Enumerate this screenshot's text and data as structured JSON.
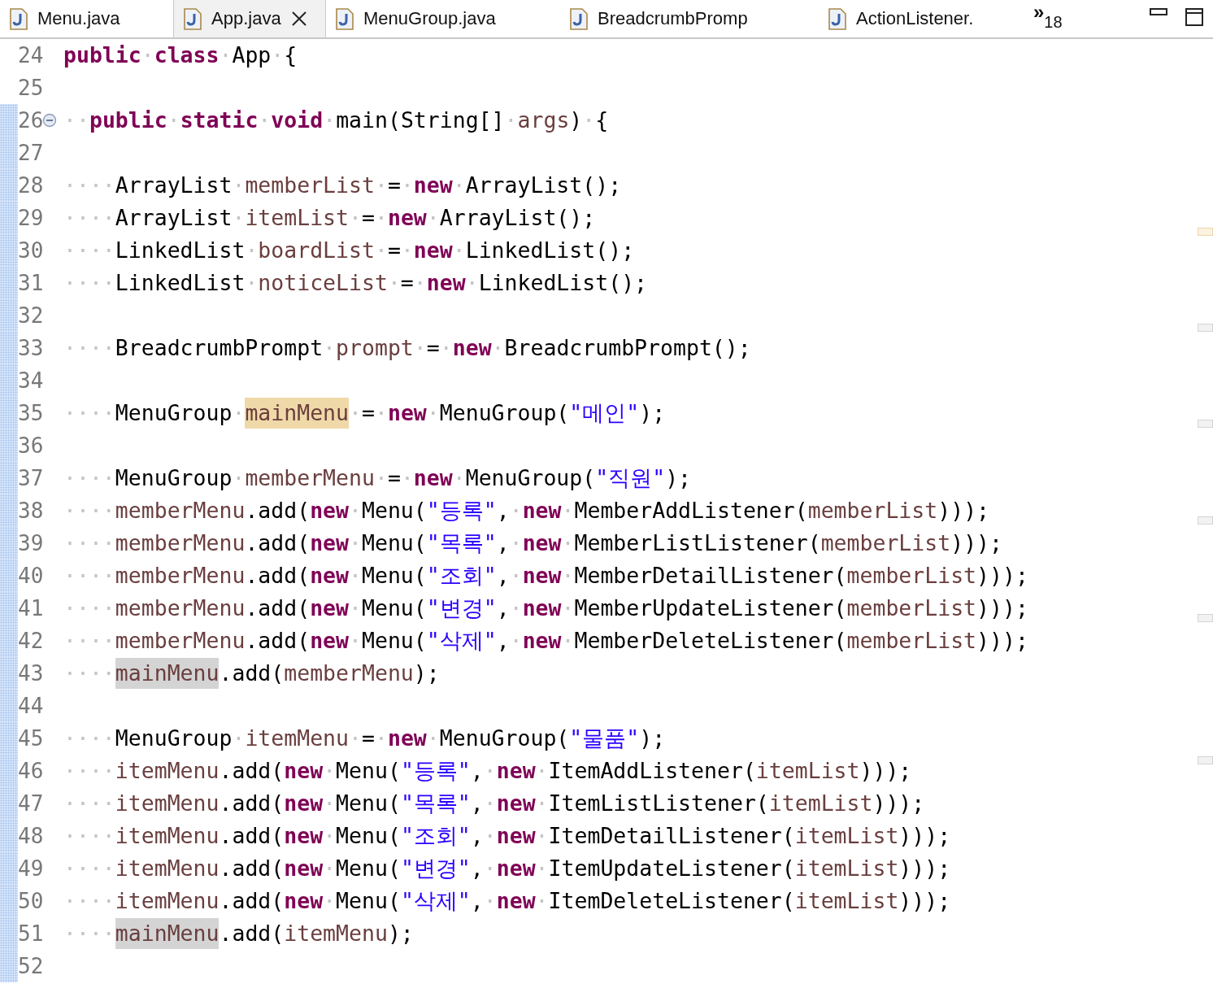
{
  "tabs": [
    {
      "label": "Menu.java",
      "selected": false
    },
    {
      "label": "App.java",
      "selected": true
    },
    {
      "label": "MenuGroup.java",
      "selected": false
    },
    {
      "label": "BreadcrumbPromp",
      "selected": false
    },
    {
      "label": "ActionListener.",
      "selected": false
    }
  ],
  "overflow": {
    "glyph": "»",
    "count": "18"
  },
  "lines": [
    {
      "number": "24",
      "in_range": false,
      "tokens": [
        {
          "kind": "kw",
          "text": "public"
        },
        {
          "kind": "ws",
          "text": "·"
        },
        {
          "kind": "kw",
          "text": "class"
        },
        {
          "kind": "ws",
          "text": "·"
        },
        {
          "kind": "id",
          "text": "App"
        },
        {
          "kind": "ws",
          "text": "·"
        },
        {
          "kind": "id",
          "text": "{"
        }
      ]
    },
    {
      "number": "25",
      "in_range": false
    },
    {
      "number": "26",
      "in_range": true,
      "collapsed": false,
      "tokens": [
        {
          "kind": "ws",
          "text": "··"
        },
        {
          "kind": "kw",
          "text": "public"
        },
        {
          "kind": "ws",
          "text": "·"
        },
        {
          "kind": "kw",
          "text": "static"
        },
        {
          "kind": "ws",
          "text": "·"
        },
        {
          "kind": "kw",
          "text": "void"
        },
        {
          "kind": "ws",
          "text": "·"
        },
        {
          "kind": "id",
          "text": "main(String[]"
        },
        {
          "kind": "ws",
          "text": "·"
        },
        {
          "kind": "var",
          "text": "args"
        },
        {
          "kind": "id",
          "text": ")"
        },
        {
          "kind": "ws",
          "text": "·"
        },
        {
          "kind": "id",
          "text": "{"
        }
      ]
    },
    {
      "number": "27",
      "in_range": true
    },
    {
      "number": "28",
      "in_range": true,
      "tokens": [
        {
          "kind": "ws",
          "text": "····"
        },
        {
          "kind": "id",
          "text": "ArrayList"
        },
        {
          "kind": "ws",
          "text": "·"
        },
        {
          "kind": "var",
          "text": "memberList"
        },
        {
          "kind": "ws",
          "text": "·"
        },
        {
          "kind": "id",
          "text": "="
        },
        {
          "kind": "ws",
          "text": "·"
        },
        {
          "kind": "kw",
          "text": "new"
        },
        {
          "kind": "ws",
          "text": "·"
        },
        {
          "kind": "id",
          "text": "ArrayList();"
        }
      ]
    },
    {
      "number": "29",
      "in_range": true,
      "tokens": [
        {
          "kind": "ws",
          "text": "····"
        },
        {
          "kind": "id",
          "text": "ArrayList"
        },
        {
          "kind": "ws",
          "text": "·"
        },
        {
          "kind": "var",
          "text": "itemList"
        },
        {
          "kind": "ws",
          "text": "·"
        },
        {
          "kind": "id",
          "text": "="
        },
        {
          "kind": "ws",
          "text": "·"
        },
        {
          "kind": "kw",
          "text": "new"
        },
        {
          "kind": "ws",
          "text": "·"
        },
        {
          "kind": "id",
          "text": "ArrayList();"
        }
      ]
    },
    {
      "number": "30",
      "in_range": true,
      "tokens": [
        {
          "kind": "ws",
          "text": "····"
        },
        {
          "kind": "id",
          "text": "LinkedList"
        },
        {
          "kind": "ws",
          "text": "·"
        },
        {
          "kind": "var",
          "text": "boardList"
        },
        {
          "kind": "ws",
          "text": "·"
        },
        {
          "kind": "id",
          "text": "="
        },
        {
          "kind": "ws",
          "text": "·"
        },
        {
          "kind": "kw",
          "text": "new"
        },
        {
          "kind": "ws",
          "text": "·"
        },
        {
          "kind": "id",
          "text": "LinkedList();"
        }
      ]
    },
    {
      "number": "31",
      "in_range": true,
      "tokens": [
        {
          "kind": "ws",
          "text": "····"
        },
        {
          "kind": "id",
          "text": "LinkedList"
        },
        {
          "kind": "ws",
          "text": "·"
        },
        {
          "kind": "var",
          "text": "noticeList"
        },
        {
          "kind": "ws",
          "text": "·"
        },
        {
          "kind": "id",
          "text": "="
        },
        {
          "kind": "ws",
          "text": "·"
        },
        {
          "kind": "kw",
          "text": "new"
        },
        {
          "kind": "ws",
          "text": "·"
        },
        {
          "kind": "id",
          "text": "LinkedList();"
        }
      ]
    },
    {
      "number": "32",
      "in_range": true
    },
    {
      "number": "33",
      "in_range": true,
      "tokens": [
        {
          "kind": "ws",
          "text": "····"
        },
        {
          "kind": "id",
          "text": "BreadcrumbPrompt"
        },
        {
          "kind": "ws",
          "text": "·"
        },
        {
          "kind": "var",
          "text": "prompt"
        },
        {
          "kind": "ws",
          "text": "·"
        },
        {
          "kind": "id",
          "text": "="
        },
        {
          "kind": "ws",
          "text": "·"
        },
        {
          "kind": "kw",
          "text": "new"
        },
        {
          "kind": "ws",
          "text": "·"
        },
        {
          "kind": "id",
          "text": "BreadcrumbPrompt();"
        }
      ]
    },
    {
      "number": "34",
      "in_range": true
    },
    {
      "number": "35",
      "in_range": true,
      "tokens": [
        {
          "kind": "ws",
          "text": "····"
        },
        {
          "kind": "id",
          "text": "MenuGroup"
        },
        {
          "kind": "ws",
          "text": "·"
        },
        {
          "kind": "var",
          "text": "mainMenu",
          "highlighted": true,
          "write_access": true
        },
        {
          "kind": "ws",
          "text": "·"
        },
        {
          "kind": "id",
          "text": "="
        },
        {
          "kind": "ws",
          "text": "·"
        },
        {
          "kind": "kw",
          "text": "new"
        },
        {
          "kind": "ws",
          "text": "·"
        },
        {
          "kind": "id",
          "text": "MenuGroup("
        },
        {
          "kind": "str",
          "text": "\"메인\""
        },
        {
          "kind": "id",
          "text": ");"
        }
      ]
    },
    {
      "number": "36",
      "in_range": true
    },
    {
      "number": "37",
      "in_range": true,
      "tokens": [
        {
          "kind": "ws",
          "text": "····"
        },
        {
          "kind": "id",
          "text": "MenuGroup"
        },
        {
          "kind": "ws",
          "text": "·"
        },
        {
          "kind": "var",
          "text": "memberMenu"
        },
        {
          "kind": "ws",
          "text": "·"
        },
        {
          "kind": "id",
          "text": "="
        },
        {
          "kind": "ws",
          "text": "·"
        },
        {
          "kind": "kw",
          "text": "new"
        },
        {
          "kind": "ws",
          "text": "·"
        },
        {
          "kind": "id",
          "text": "MenuGroup("
        },
        {
          "kind": "str",
          "text": "\"직원\""
        },
        {
          "kind": "id",
          "text": ");"
        }
      ]
    },
    {
      "number": "38",
      "in_range": true,
      "tokens": [
        {
          "kind": "ws",
          "text": "····"
        },
        {
          "kind": "var",
          "text": "memberMenu"
        },
        {
          "kind": "id",
          "text": ".add("
        },
        {
          "kind": "kw",
          "text": "new"
        },
        {
          "kind": "ws",
          "text": "·"
        },
        {
          "kind": "id",
          "text": "Menu("
        },
        {
          "kind": "str",
          "text": "\"등록\""
        },
        {
          "kind": "id",
          "text": ","
        },
        {
          "kind": "ws",
          "text": "·"
        },
        {
          "kind": "kw",
          "text": "new"
        },
        {
          "kind": "ws",
          "text": "·"
        },
        {
          "kind": "id",
          "text": "MemberAddListener("
        },
        {
          "kind": "var",
          "text": "memberList"
        },
        {
          "kind": "id",
          "text": ")));"
        }
      ]
    },
    {
      "number": "39",
      "in_range": true,
      "tokens": [
        {
          "kind": "ws",
          "text": "····"
        },
        {
          "kind": "var",
          "text": "memberMenu"
        },
        {
          "kind": "id",
          "text": ".add("
        },
        {
          "kind": "kw",
          "text": "new"
        },
        {
          "kind": "ws",
          "text": "·"
        },
        {
          "kind": "id",
          "text": "Menu("
        },
        {
          "kind": "str",
          "text": "\"목록\""
        },
        {
          "kind": "id",
          "text": ","
        },
        {
          "kind": "ws",
          "text": "·"
        },
        {
          "kind": "kw",
          "text": "new"
        },
        {
          "kind": "ws",
          "text": "·"
        },
        {
          "kind": "id",
          "text": "MemberListListener("
        },
        {
          "kind": "var",
          "text": "memberList"
        },
        {
          "kind": "id",
          "text": ")));"
        }
      ]
    },
    {
      "number": "40",
      "in_range": true,
      "tokens": [
        {
          "kind": "ws",
          "text": "····"
        },
        {
          "kind": "var",
          "text": "memberMenu"
        },
        {
          "kind": "id",
          "text": ".add("
        },
        {
          "kind": "kw",
          "text": "new"
        },
        {
          "kind": "ws",
          "text": "·"
        },
        {
          "kind": "id",
          "text": "Menu("
        },
        {
          "kind": "str",
          "text": "\"조회\""
        },
        {
          "kind": "id",
          "text": ","
        },
        {
          "kind": "ws",
          "text": "·"
        },
        {
          "kind": "kw",
          "text": "new"
        },
        {
          "kind": "ws",
          "text": "·"
        },
        {
          "kind": "id",
          "text": "MemberDetailListener("
        },
        {
          "kind": "var",
          "text": "memberList"
        },
        {
          "kind": "id",
          "text": ")));"
        }
      ]
    },
    {
      "number": "41",
      "in_range": true,
      "tokens": [
        {
          "kind": "ws",
          "text": "····"
        },
        {
          "kind": "var",
          "text": "memberMenu"
        },
        {
          "kind": "id",
          "text": ".add("
        },
        {
          "kind": "kw",
          "text": "new"
        },
        {
          "kind": "ws",
          "text": "·"
        },
        {
          "kind": "id",
          "text": "Menu("
        },
        {
          "kind": "str",
          "text": "\"변경\""
        },
        {
          "kind": "id",
          "text": ","
        },
        {
          "kind": "ws",
          "text": "·"
        },
        {
          "kind": "kw",
          "text": "new"
        },
        {
          "kind": "ws",
          "text": "·"
        },
        {
          "kind": "id",
          "text": "MemberUpdateListener("
        },
        {
          "kind": "var",
          "text": "memberList"
        },
        {
          "kind": "id",
          "text": ")));"
        }
      ]
    },
    {
      "number": "42",
      "in_range": true,
      "tokens": [
        {
          "kind": "ws",
          "text": "····"
        },
        {
          "kind": "var",
          "text": "memberMenu"
        },
        {
          "kind": "id",
          "text": ".add("
        },
        {
          "kind": "kw",
          "text": "new"
        },
        {
          "kind": "ws",
          "text": "·"
        },
        {
          "kind": "id",
          "text": "Menu("
        },
        {
          "kind": "str",
          "text": "\"삭제\""
        },
        {
          "kind": "id",
          "text": ","
        },
        {
          "kind": "ws",
          "text": "·"
        },
        {
          "kind": "kw",
          "text": "new"
        },
        {
          "kind": "ws",
          "text": "·"
        },
        {
          "kind": "id",
          "text": "MemberDeleteListener("
        },
        {
          "kind": "var",
          "text": "memberList"
        },
        {
          "kind": "id",
          "text": ")));"
        }
      ]
    },
    {
      "number": "43",
      "in_range": true,
      "tokens": [
        {
          "kind": "ws",
          "text": "····"
        },
        {
          "kind": "var",
          "text": "mainMenu",
          "highlighted": true,
          "write_access": false
        },
        {
          "kind": "id",
          "text": ".add("
        },
        {
          "kind": "var",
          "text": "memberMenu"
        },
        {
          "kind": "id",
          "text": ");"
        }
      ]
    },
    {
      "number": "44",
      "in_range": true
    },
    {
      "number": "45",
      "in_range": true,
      "tokens": [
        {
          "kind": "ws",
          "text": "····"
        },
        {
          "kind": "id",
          "text": "MenuGroup"
        },
        {
          "kind": "ws",
          "text": "·"
        },
        {
          "kind": "var",
          "text": "itemMenu"
        },
        {
          "kind": "ws",
          "text": "·"
        },
        {
          "kind": "id",
          "text": "="
        },
        {
          "kind": "ws",
          "text": "·"
        },
        {
          "kind": "kw",
          "text": "new"
        },
        {
          "kind": "ws",
          "text": "·"
        },
        {
          "kind": "id",
          "text": "MenuGroup("
        },
        {
          "kind": "str",
          "text": "\"물품\""
        },
        {
          "kind": "id",
          "text": ");"
        }
      ]
    },
    {
      "number": "46",
      "in_range": true,
      "tokens": [
        {
          "kind": "ws",
          "text": "····"
        },
        {
          "kind": "var",
          "text": "itemMenu"
        },
        {
          "kind": "id",
          "text": ".add("
        },
        {
          "kind": "kw",
          "text": "new"
        },
        {
          "kind": "ws",
          "text": "·"
        },
        {
          "kind": "id",
          "text": "Menu("
        },
        {
          "kind": "str",
          "text": "\"등록\""
        },
        {
          "kind": "id",
          "text": ","
        },
        {
          "kind": "ws",
          "text": "·"
        },
        {
          "kind": "kw",
          "text": "new"
        },
        {
          "kind": "ws",
          "text": "·"
        },
        {
          "kind": "id",
          "text": "ItemAddListener("
        },
        {
          "kind": "var",
          "text": "itemList"
        },
        {
          "kind": "id",
          "text": ")));"
        }
      ]
    },
    {
      "number": "47",
      "in_range": true,
      "tokens": [
        {
          "kind": "ws",
          "text": "····"
        },
        {
          "kind": "var",
          "text": "itemMenu"
        },
        {
          "kind": "id",
          "text": ".add("
        },
        {
          "kind": "kw",
          "text": "new"
        },
        {
          "kind": "ws",
          "text": "·"
        },
        {
          "kind": "id",
          "text": "Menu("
        },
        {
          "kind": "str",
          "text": "\"목록\""
        },
        {
          "kind": "id",
          "text": ","
        },
        {
          "kind": "ws",
          "text": "·"
        },
        {
          "kind": "kw",
          "text": "new"
        },
        {
          "kind": "ws",
          "text": "·"
        },
        {
          "kind": "id",
          "text": "ItemListListener("
        },
        {
          "kind": "var",
          "text": "itemList"
        },
        {
          "kind": "id",
          "text": ")));"
        }
      ]
    },
    {
      "number": "48",
      "in_range": true,
      "tokens": [
        {
          "kind": "ws",
          "text": "····"
        },
        {
          "kind": "var",
          "text": "itemMenu"
        },
        {
          "kind": "id",
          "text": ".add("
        },
        {
          "kind": "kw",
          "text": "new"
        },
        {
          "kind": "ws",
          "text": "·"
        },
        {
          "kind": "id",
          "text": "Menu("
        },
        {
          "kind": "str",
          "text": "\"조회\""
        },
        {
          "kind": "id",
          "text": ","
        },
        {
          "kind": "ws",
          "text": "·"
        },
        {
          "kind": "kw",
          "text": "new"
        },
        {
          "kind": "ws",
          "text": "·"
        },
        {
          "kind": "id",
          "text": "ItemDetailListener("
        },
        {
          "kind": "var",
          "text": "itemList"
        },
        {
          "kind": "id",
          "text": ")));"
        }
      ]
    },
    {
      "number": "49",
      "in_range": true,
      "tokens": [
        {
          "kind": "ws",
          "text": "····"
        },
        {
          "kind": "var",
          "text": "itemMenu"
        },
        {
          "kind": "id",
          "text": ".add("
        },
        {
          "kind": "kw",
          "text": "new"
        },
        {
          "kind": "ws",
          "text": "·"
        },
        {
          "kind": "id",
          "text": "Menu("
        },
        {
          "kind": "str",
          "text": "\"변경\""
        },
        {
          "kind": "id",
          "text": ","
        },
        {
          "kind": "ws",
          "text": "·"
        },
        {
          "kind": "kw",
          "text": "new"
        },
        {
          "kind": "ws",
          "text": "·"
        },
        {
          "kind": "id",
          "text": "ItemUpdateListener("
        },
        {
          "kind": "var",
          "text": "itemList"
        },
        {
          "kind": "id",
          "text": ")));"
        }
      ]
    },
    {
      "number": "50",
      "in_range": true,
      "tokens": [
        {
          "kind": "ws",
          "text": "····"
        },
        {
          "kind": "var",
          "text": "itemMenu"
        },
        {
          "kind": "id",
          "text": ".add("
        },
        {
          "kind": "kw",
          "text": "new"
        },
        {
          "kind": "ws",
          "text": "·"
        },
        {
          "kind": "id",
          "text": "Menu("
        },
        {
          "kind": "str",
          "text": "\"삭제\""
        },
        {
          "kind": "id",
          "text": ","
        },
        {
          "kind": "ws",
          "text": "·"
        },
        {
          "kind": "kw",
          "text": "new"
        },
        {
          "kind": "ws",
          "text": "·"
        },
        {
          "kind": "id",
          "text": "ItemDeleteListener("
        },
        {
          "kind": "var",
          "text": "itemList"
        },
        {
          "kind": "id",
          "text": ")));"
        }
      ]
    },
    {
      "number": "51",
      "in_range": true,
      "tokens": [
        {
          "kind": "ws",
          "text": "····"
        },
        {
          "kind": "var",
          "text": "mainMenu",
          "highlighted": true,
          "write_access": false
        },
        {
          "kind": "id",
          "text": ".add("
        },
        {
          "kind": "var",
          "text": "itemMenu"
        },
        {
          "kind": "id",
          "text": ");"
        }
      ]
    },
    {
      "number": "52",
      "in_range": true
    }
  ]
}
